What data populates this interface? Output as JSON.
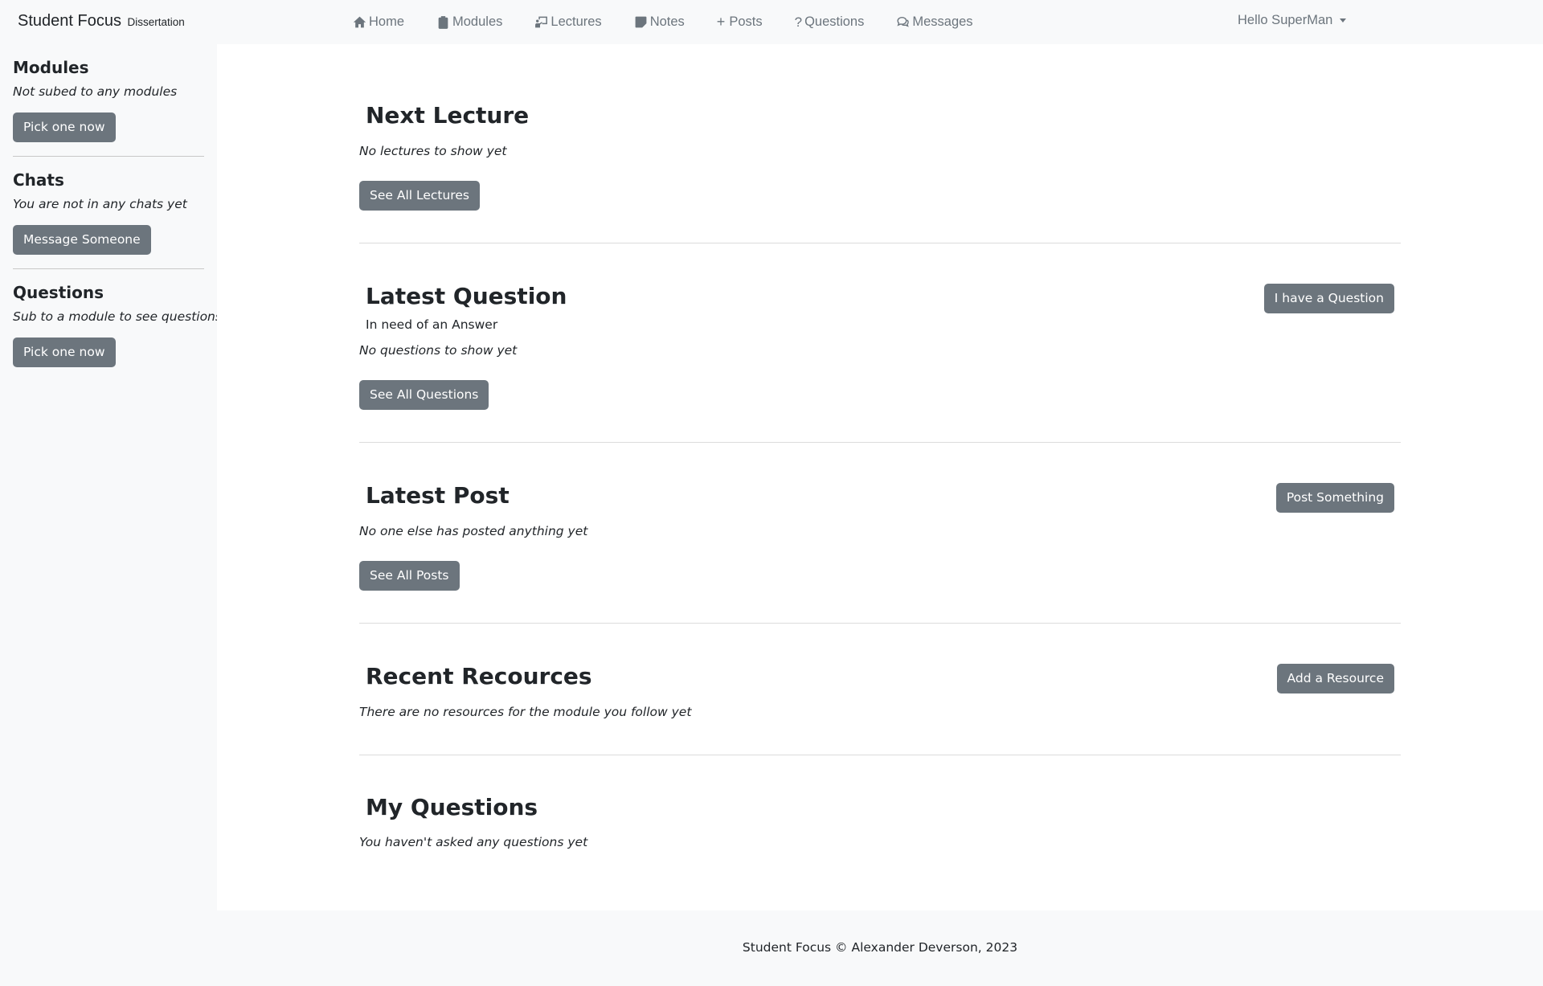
{
  "navbar": {
    "brand": "Student Focus",
    "brand_sub": "Dissertation",
    "links": [
      {
        "label": "Home",
        "icon": "house-icon"
      },
      {
        "label": "Modules",
        "icon": "clipboard-icon"
      },
      {
        "label": "Lectures",
        "icon": "person-board-icon"
      },
      {
        "label": "Notes",
        "icon": "sticky-note-icon"
      },
      {
        "label": "Posts",
        "icon": "plus-icon"
      },
      {
        "label": "Questions",
        "icon": "question-icon"
      },
      {
        "label": "Messages",
        "icon": "chat-bubbles-icon"
      }
    ],
    "user_menu": "Hello SuperMan"
  },
  "sidebar": {
    "modules": {
      "title": "Modules",
      "text": "Not subed to any modules",
      "button": "Pick one now"
    },
    "chats": {
      "title": "Chats",
      "text": "You are not in any chats yet",
      "button": "Message Someone"
    },
    "questions": {
      "title": "Questions",
      "text": "Sub to a module to see questions",
      "button": "Pick one now"
    }
  },
  "main": {
    "next_lecture": {
      "title": "Next Lecture",
      "text": "No lectures to show yet",
      "button": "See All Lectures"
    },
    "latest_question": {
      "title": "Latest Question",
      "subtitle": "In need of an Answer",
      "text": "No questions to show yet",
      "button": "See All Questions",
      "action_button": "I have a Question"
    },
    "latest_post": {
      "title": "Latest Post",
      "text": "No one else has posted anything yet",
      "button": "See All Posts",
      "action_button": "Post Something"
    },
    "recent_resources": {
      "title": "Recent Recources",
      "text": "There are no resources for the module you follow yet",
      "action_button": "Add a Resource"
    },
    "my_questions": {
      "title": "My Questions",
      "text": "You haven't asked any questions yet"
    }
  },
  "footer": {
    "text": "Student Focus © Alexander Deverson, 2023"
  },
  "colors": {
    "button_bg": "#6c757d",
    "nav_text": "#6c757d",
    "page_bg": "#f8f9fa",
    "main_bg": "#ffffff"
  }
}
